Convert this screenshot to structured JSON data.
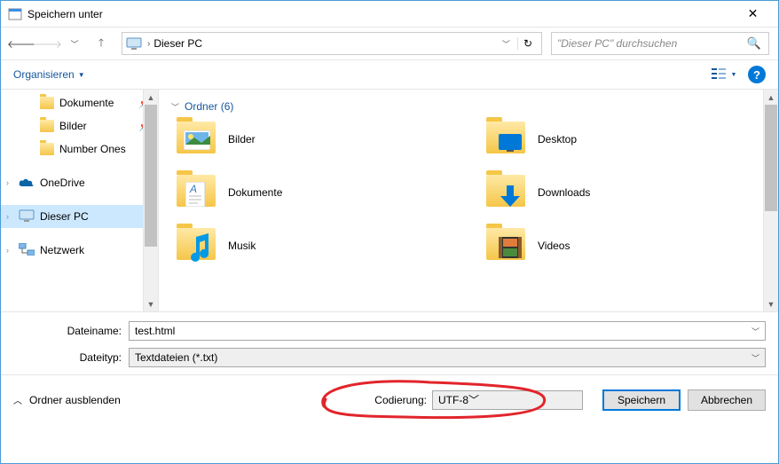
{
  "title": "Speichern unter",
  "address": {
    "location": "Dieser PC"
  },
  "search": {
    "placeholder": "\"Dieser PC\" durchsuchen"
  },
  "toolbar": {
    "organize": "Organisieren"
  },
  "nav": {
    "items": [
      {
        "label": "Dokumente",
        "kind": "folder",
        "pinned": true,
        "indent": true
      },
      {
        "label": "Bilder",
        "kind": "folder",
        "pinned": true,
        "indent": true
      },
      {
        "label": "Number Ones",
        "kind": "folder",
        "indent": true
      },
      {
        "label": "OneDrive",
        "kind": "onedrive",
        "expandable": true
      },
      {
        "label": "Dieser PC",
        "kind": "pc",
        "expandable": true,
        "selected": true
      },
      {
        "label": "Netzwerk",
        "kind": "network",
        "expandable": true
      }
    ]
  },
  "content": {
    "group_label": "Ordner (6)",
    "folders": [
      {
        "label": "Bilder",
        "kind": "pictures"
      },
      {
        "label": "Desktop",
        "kind": "desktop"
      },
      {
        "label": "Dokumente",
        "kind": "documents"
      },
      {
        "label": "Downloads",
        "kind": "downloads"
      },
      {
        "label": "Musik",
        "kind": "music"
      },
      {
        "label": "Videos",
        "kind": "videos"
      }
    ]
  },
  "fields": {
    "filename_label": "Dateiname:",
    "filename_value": "test.html",
    "filetype_label": "Dateityp:",
    "filetype_value": "Textdateien (*.txt)"
  },
  "footer": {
    "hide_folders": "Ordner ausblenden",
    "encoding_label": "Codierung:",
    "encoding_value": "UTF-8",
    "save": "Speichern",
    "cancel": "Abbrechen"
  }
}
